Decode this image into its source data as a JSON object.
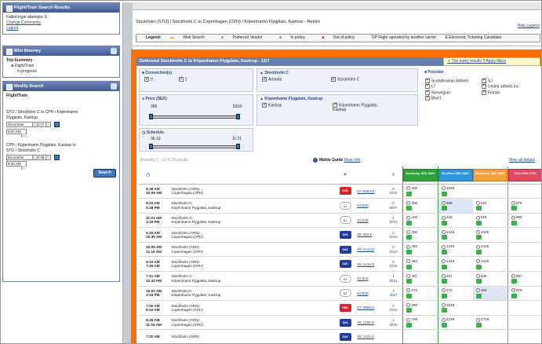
{
  "sidebar": {
    "results_panel": {
      "title": "Flight/Train Search Results",
      "failed_login": "Failed login attempts: 0",
      "links": [
        "Change Community",
        "Logout"
      ]
    },
    "itinerary_panel": {
      "title": "Mini Itinerary",
      "summary_label": "Trip Summary",
      "item": "Flight/Train",
      "status": "in progress"
    },
    "modify_panel": {
      "title": "Modify Search",
      "heading": "Flight/Train",
      "leg1": "STO / Stockholm C to CPH / Köpenhamn Flygplats, Kastrup",
      "leg1_month": "December",
      "leg1_day": "07",
      "leg1_time": "8:00 AM",
      "leg2": "CPH / Köpenhamn Flygplats, Kastrup to STO / Stockholm C",
      "leg2_month": "December",
      "leg2_day": "08",
      "leg2_time": "8:00 AM",
      "search_button": "Search"
    }
  },
  "header": {
    "route": "Stockholm (STO) / Stockholm C to Copenhagen (CPH) / Köpenhamn Flygplats, Kastrup - Return",
    "help": "Help Legend",
    "legend_title": "Legend:",
    "legend_items": [
      "Web Search",
      "Preferred Vendor",
      "In policy",
      "Out of policy",
      "OP Flight operated by another carrier",
      "E Electronic Ticketing Candidate"
    ]
  },
  "results": {
    "outbound_title": "Outbound Stockholm C to Köpenhamn Flygplats, Kastrup - 12/7",
    "too_many": "Too many results ? Apply filters",
    "filters": {
      "connections_title": "Connection(s)",
      "connections": [
        "0",
        "1"
      ],
      "price_title": "Price (SEK)",
      "price_min": "300",
      "price_max": "5318",
      "schedule_title": "Schedule",
      "schedule_min": "06:10",
      "schedule_max": "11:21",
      "stockholm_title": "Stockholm C",
      "stockholm_opts": [
        "Arlanda",
        "Stockholm C"
      ],
      "cph_title": "Köpenhamn Flygplats, Kastrup",
      "cph_opts": [
        "Kastrup",
        "Köpenhamn Flygplats, Kastrup"
      ],
      "provider_title": "Provider",
      "providers": [
        "Scandinavian Airlines",
        "SJ",
        "LT",
        "United airlines inc",
        "Norwegian",
        "Finnair",
        "Blue1"
      ]
    },
    "showing": "Showing 1 - 10 of 28 results",
    "matrix_guide": "Matrix Guide",
    "more_info": "More info",
    "view_all": "View all details",
    "columns": {
      "economy": "Economy SEK 300+",
      "flex": "EcoFlex SEK 986+",
      "business": "Business SEK 306+",
      "first": "First SEK 979+"
    },
    "rows": [
      {
        "dep": "8:45 AM",
        "arr": "10:09 AM",
        "from": "Stockholm (ARN)",
        "to": "Copenhagen (CPH)",
        "carrier": "NSB",
        "flight": "DY 0883 E",
        "stops": "0",
        "dur": "1h24",
        "fares": [
          "300",
          "1038",
          "",
          ""
        ]
      },
      {
        "dep": "8:21 AM",
        "arr": "5:28 PM",
        "from": "Stockholm C",
        "to": "Köpenhamn Flygplats, Kastrup",
        "carrier": "SJ",
        "flight": "SJ 526",
        "stops": "0",
        "dur": "9h07",
        "fares": [
          "396",
          "396",
          "522",
          "979"
        ]
      },
      {
        "dep": "11:21 AM",
        "arr": "4:43 PM",
        "from": "Stockholm C",
        "to": "Köpenhamn Flygplats, Kastrup",
        "carrier": "SJ",
        "flight": "SJ 528",
        "stops": "1",
        "dur": "5h22",
        "fares": [
          "426",
          "426",
          "518",
          "986"
        ]
      },
      {
        "dep": "9:20 AM",
        "arr": "10:30 AM",
        "from": "Stockholm (ARN)",
        "to": "Copenhagen (CPH)",
        "carrier": "SAS",
        "flight": "SK 403 E",
        "stops": "0",
        "dur": "1h10",
        "fares": [
          "450",
          "1425",
          "1425",
          ""
        ]
      },
      {
        "dep": "10:00 AM",
        "arr": "11:10 AM",
        "from": "Stockholm (ARN)",
        "to": "Copenhagen (CPH)",
        "carrier": "SAS",
        "flight": "SK 1413 E",
        "stops": "0",
        "dur": "1h10",
        "fares": [
          "450",
          "1425",
          "1425",
          ""
        ]
      },
      {
        "dep": "6:10 AM",
        "arr": "7:25 AM",
        "from": "Stockholm (ARN)",
        "to": "Copenhagen (CPH)",
        "carrier": "SAS",
        "flight": "SK 1415 E",
        "stops": "0",
        "dur": "1h15",
        "fares": [
          "450",
          "1425",
          "1425",
          ""
        ]
      },
      {
        "dep": "7:21 AM",
        "arr": "12:42 PM",
        "from": "Stockholm C",
        "to": "Köpenhamn Flygplats, Kastrup",
        "carrier": "SJ",
        "flight": "SJ 523",
        "stops": "1",
        "dur": "5h21",
        "fares": [
          "451",
          "451",
          "536",
          "987"
        ]
      },
      {
        "dep": "10:21 AM",
        "arr": "3:18 PM",
        "from": "Stockholm C",
        "to": "Köpenhamn Flygplats, Kastrup",
        "carrier": "SJ",
        "flight": "SJ 529",
        "stops": "1",
        "dur": "4h57",
        "fares": [
          "472",
          "472",
          "484",
          "979"
        ]
      },
      {
        "dep": "7:00 AM",
        "arr": "8:10 AM",
        "from": "Stockholm (ARN)",
        "to": "Copenhagen (CPH)",
        "carrier": "NSB",
        "flight": "DY 3885 E",
        "stops": "0",
        "dur": "1h10",
        "fares": [
          "490",
          "1038",
          "",
          ""
        ]
      },
      {
        "dep": "8:25 AM",
        "arr": "11:15 AM",
        "from": "Stockholm (ARN)",
        "to": "Copenhagen (CPH)",
        "carrier": "SAS",
        "flight": "SK 1405 E",
        "stops": "1",
        "dur": "2h50",
        "fares": [
          "799",
          "2729",
          "2729",
          ""
        ]
      },
      {
        "dep": "7:20 AM",
        "arr": "",
        "from": "Stockholm (ARN)",
        "to": "",
        "carrier": "SAS",
        "flight": "SK 1401 E",
        "stops": "",
        "dur": "",
        "fares": [
          "",
          "",
          "",
          ""
        ]
      }
    ]
  }
}
